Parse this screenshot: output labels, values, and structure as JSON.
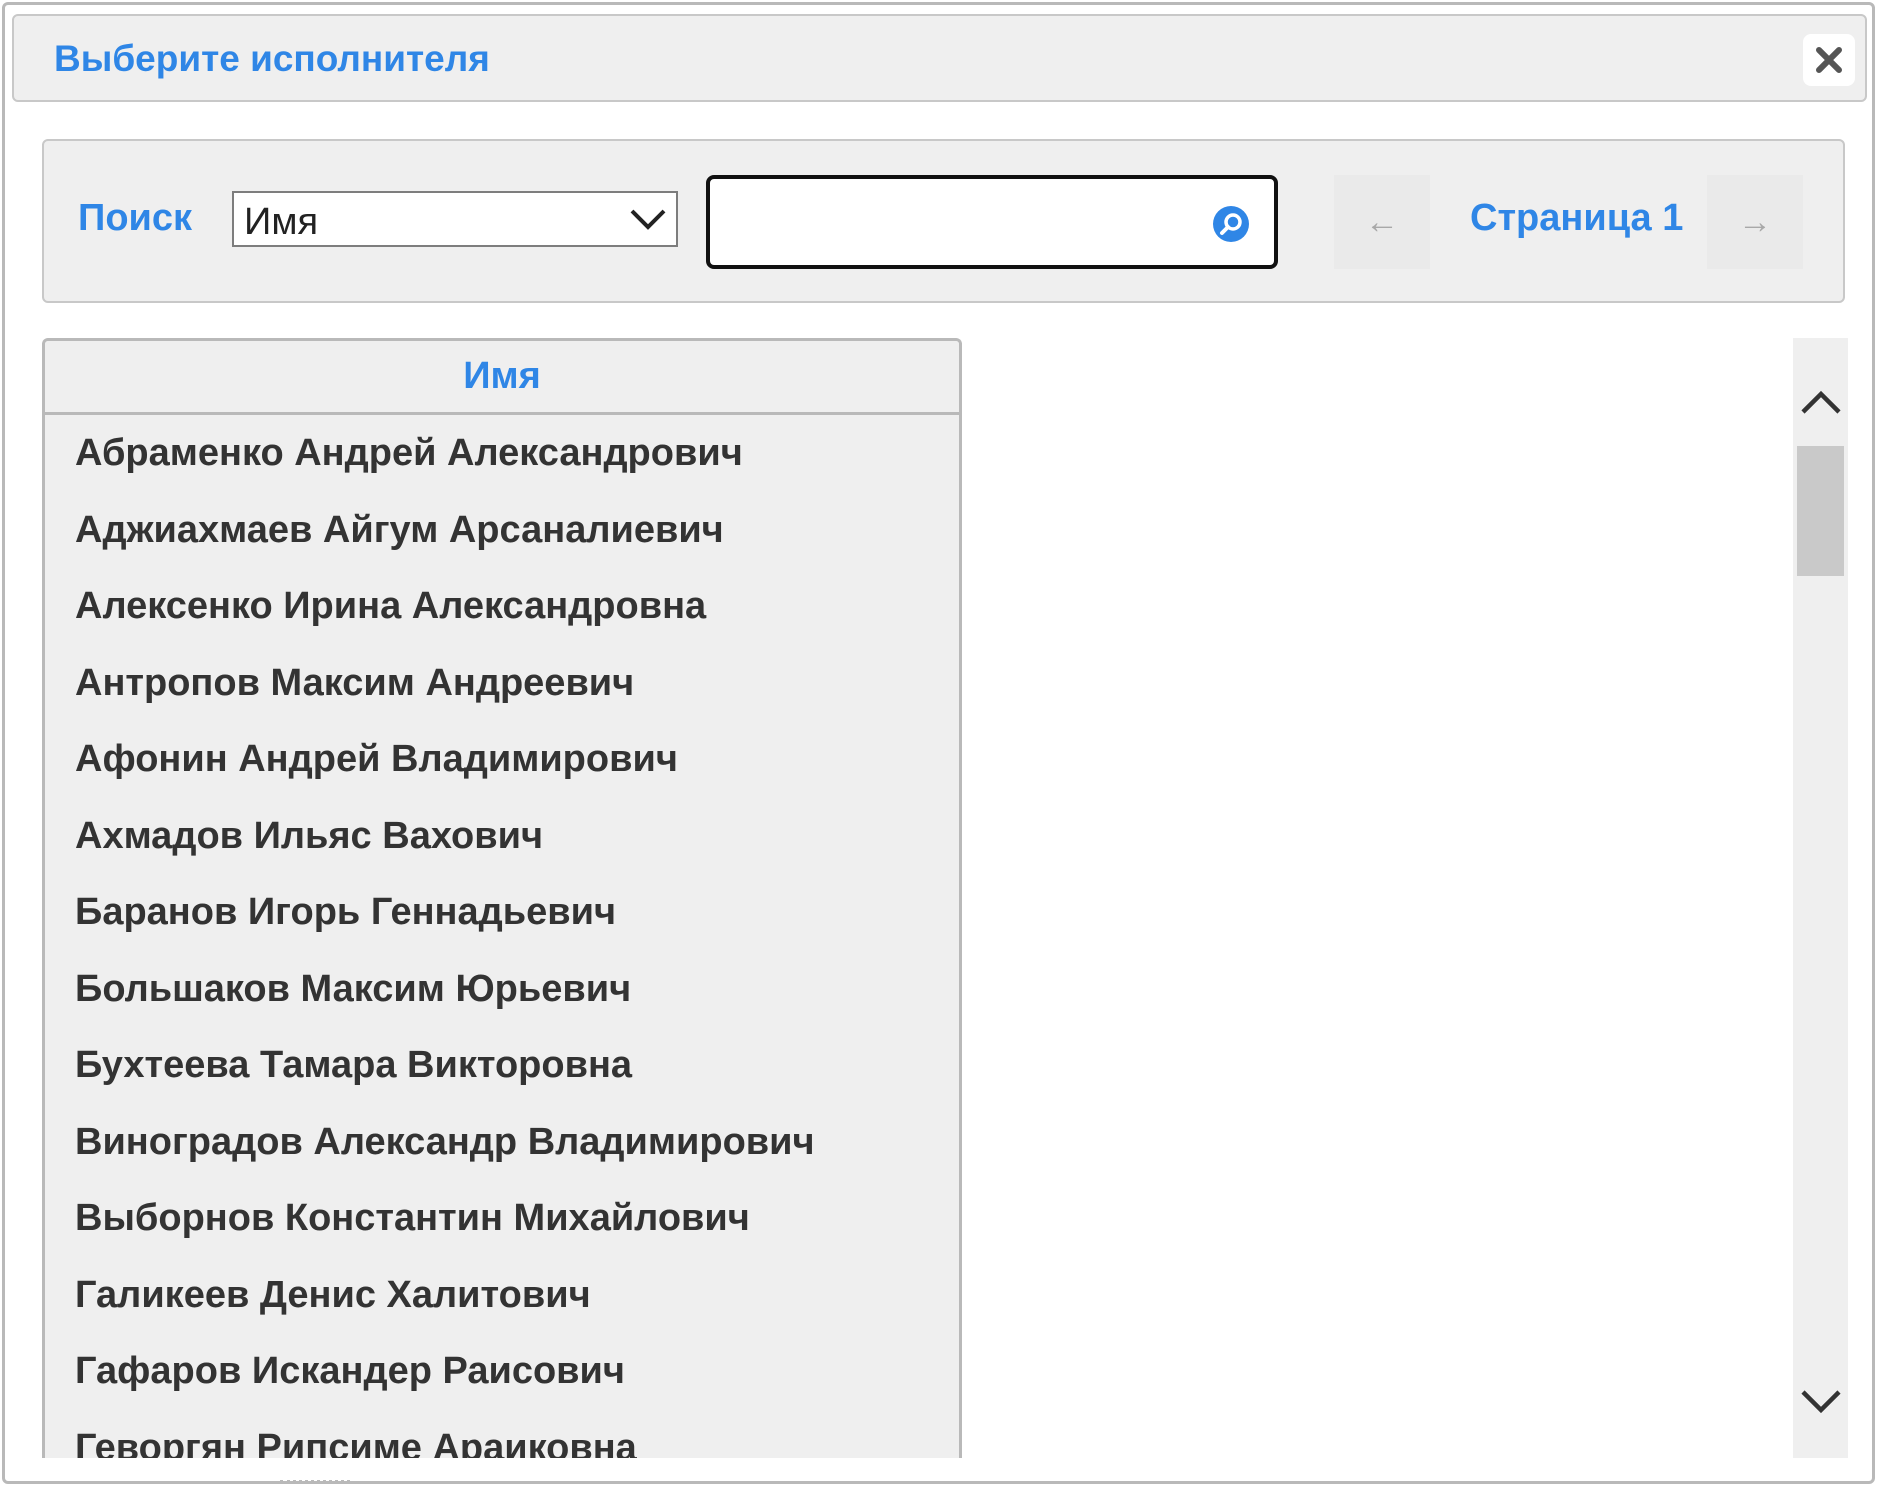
{
  "dialog": {
    "title": "Выберите исполнителя",
    "close_icon": "close-icon"
  },
  "toolbar": {
    "search_label": "Поиск",
    "field_select_value": "Имя",
    "search_input_value": "",
    "search_icon": "magnifier-icon",
    "pager_prev": "←",
    "pager_label": "Страница 1",
    "pager_next": "→"
  },
  "grid": {
    "column_header": "Имя",
    "rows": [
      "Абраменко Андрей Александрович",
      "Аджиахмаев Айгум Арсаналиевич",
      "Алексенко Ирина Александровна",
      "Антропов Максим Андреевич",
      "Афонин Андрей Владимирович",
      "Ахмадов Ильяс Вахович",
      "Баранов Игорь Геннадьевич",
      "Большаков Максим Юрьевич",
      "Бухтеева Тамара Викторовна",
      "Виноградов Александр Владимирович",
      "Выборнов Константин Михайлович",
      "Галикеев Денис Халитович",
      "Гафаров Искандер Раисович",
      "Геворгян Рипсиме Араиковна"
    ]
  },
  "colors": {
    "accent": "#2f86e6",
    "panel_bg": "#efefef",
    "border": "#b9b9b9"
  }
}
